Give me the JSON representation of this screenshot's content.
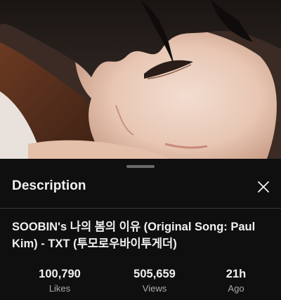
{
  "panel": {
    "title": "Description",
    "close_icon": "close-icon"
  },
  "video": {
    "title": "SOOBIN's 나의 봄의 이유 (Original Song: Paul Kim) - TXT (투모로우바이투게더)"
  },
  "stats": [
    {
      "value": "100,790",
      "label": "Likes"
    },
    {
      "value": "505,659",
      "label": "Views"
    },
    {
      "value": "21h",
      "label": "Ago"
    }
  ]
}
